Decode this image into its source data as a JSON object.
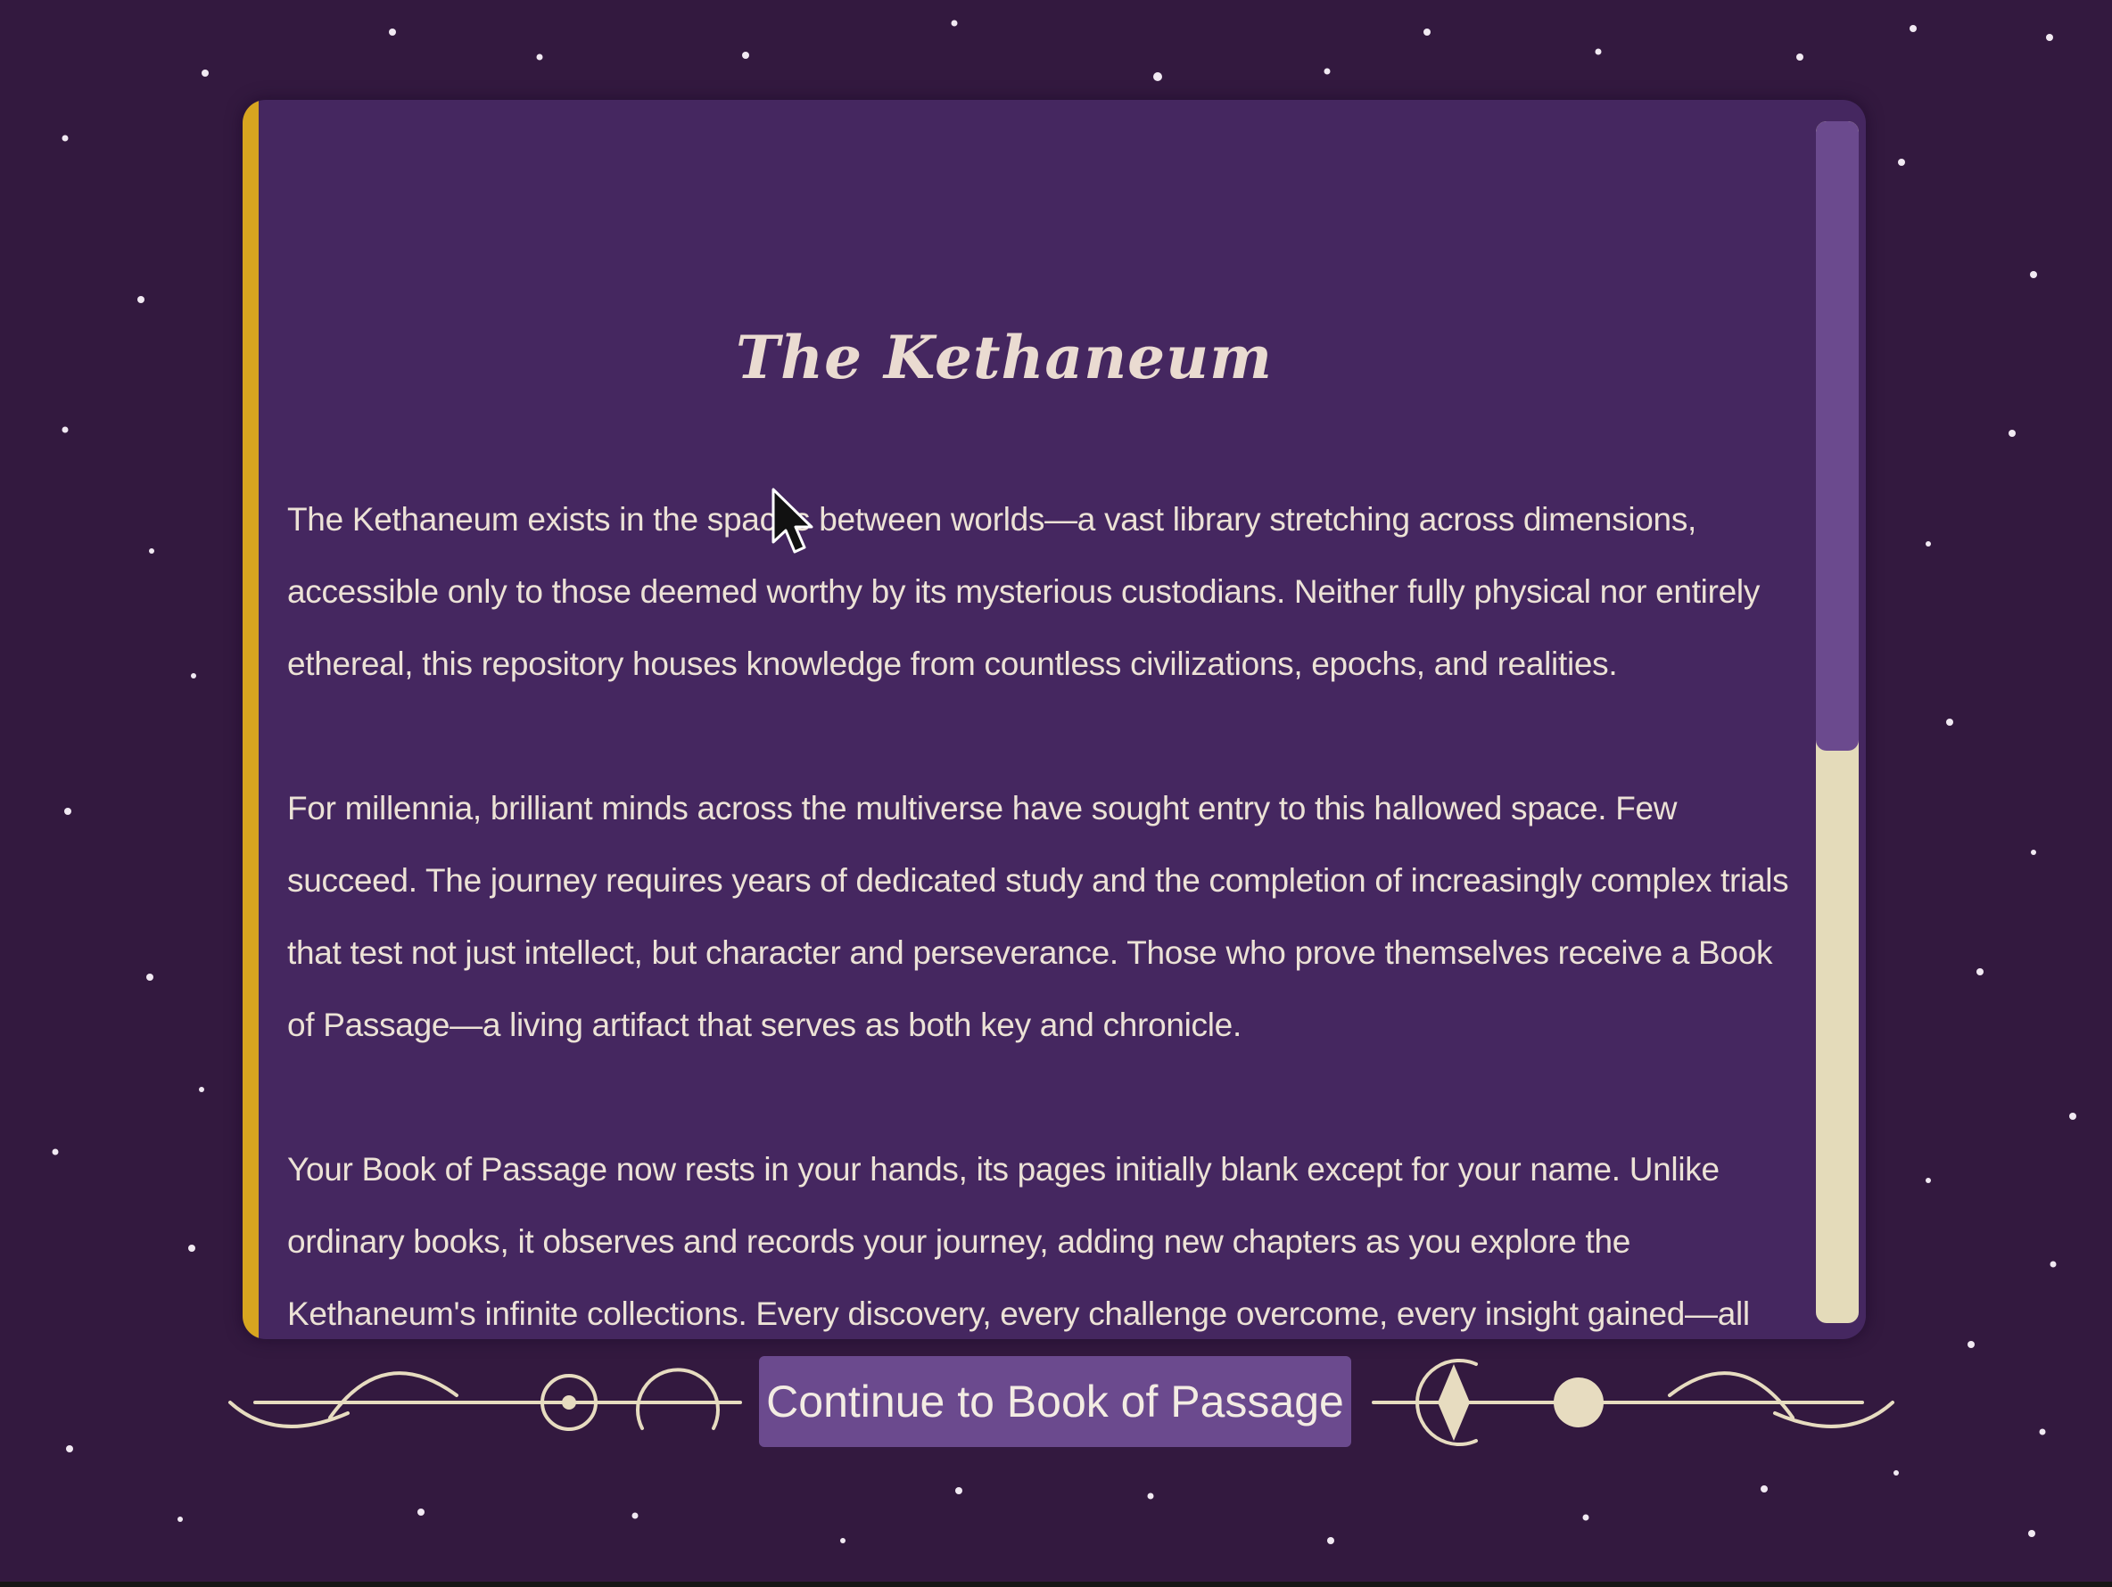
{
  "panel": {
    "title": "The Kethaneum",
    "paragraphs": [
      "The Kethaneum exists in the spaces between worlds—a vast library stretching across dimensions, accessible only to those deemed worthy by its mysterious custodians. Neither fully physical nor entirely ethereal, this repository houses knowledge from countless civilizations, epochs, and realities.",
      "For millennia, brilliant minds across the multiverse have sought entry to this hallowed space. Few succeed. The journey requires years of dedicated study and the completion of increasingly complex trials that test not just intellect, but character and perseverance. Those who prove themselves receive a Book of Passage—a living artifact that serves as both key and chronicle.",
      "Your Book of Passage now rests in your hands, its pages initially blank except for your name. Unlike ordinary books, it observes and records your journey, adding new chapters as you explore the Kethaneum's infinite collections. Every discovery, every challenge overcome, every insight gained—all become part of your unique narrative, preserved within its pages."
    ]
  },
  "continue_button": {
    "label": "Continue to Book of Passage"
  },
  "colors": {
    "background": "#33193f",
    "panel": "#452760",
    "spine": "#d8a520",
    "accent": "#6b4a8e",
    "ornament": "#e7dcc0",
    "text": "#ece2d6"
  },
  "icons": {
    "cursor": "arrow-cursor-icon",
    "ornament_left": "flourish-left-icon",
    "ornament_right": "flourish-right-icon"
  }
}
